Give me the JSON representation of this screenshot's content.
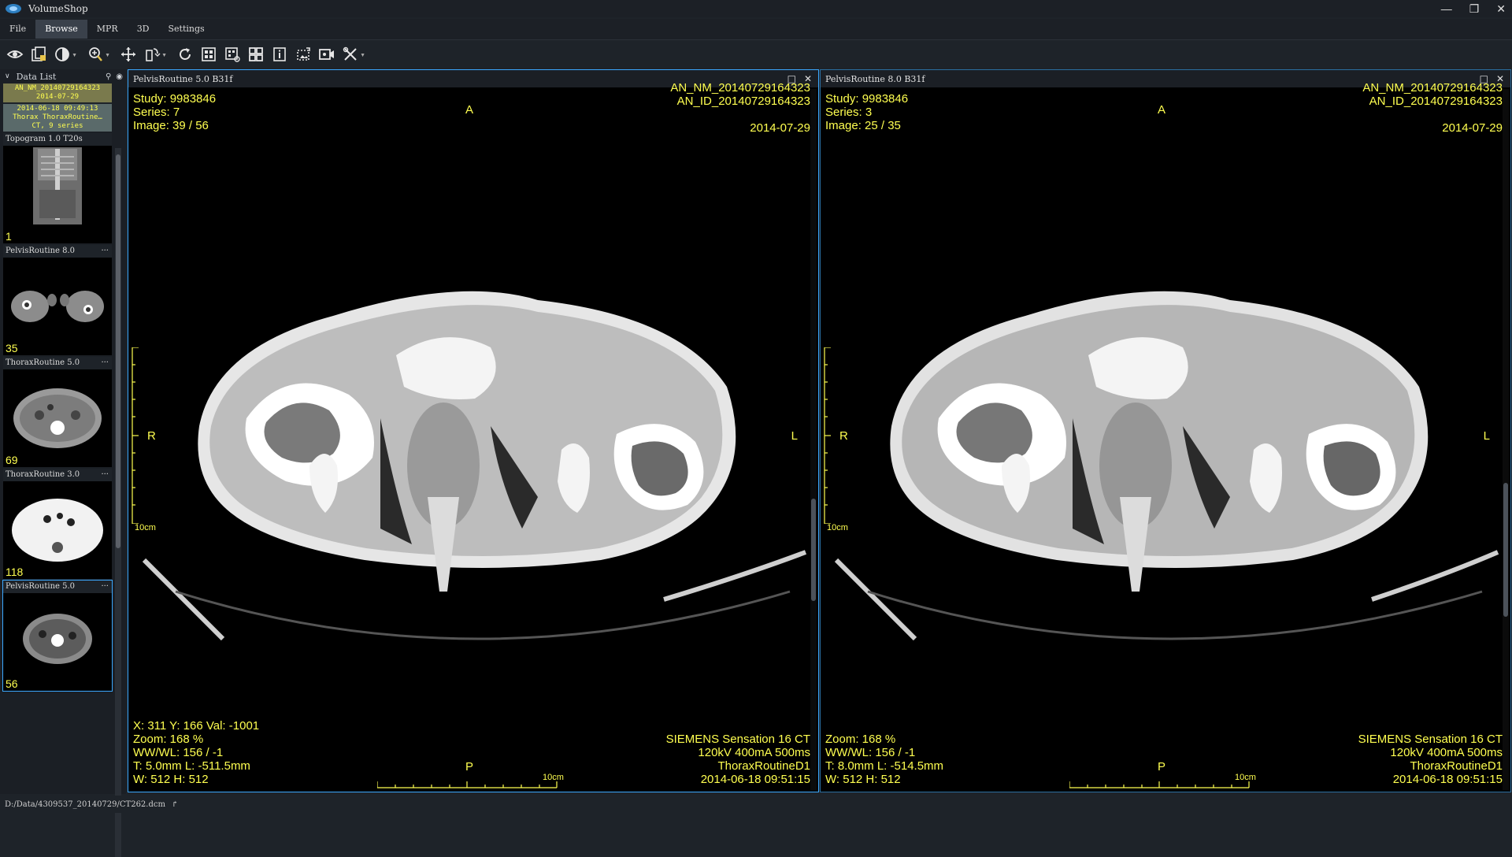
{
  "window": {
    "title": "VolumeShop"
  },
  "menu": [
    "File",
    "Browse",
    "MPR",
    "3D",
    "Settings"
  ],
  "menu_active": "Browse",
  "toolbar_icons": [
    "eye-icon",
    "layers-icon",
    "contrast-icon",
    "zoom-icon",
    "pan-icon",
    "flip-icon",
    "rotate-icon",
    "grid-icon",
    "layout-icon",
    "tiles-icon",
    "info-icon",
    "crop-icon",
    "video-icon",
    "tools-icon"
  ],
  "data_list": {
    "header": "Data List",
    "patient": {
      "name_line": "AN_NM_20140729164323",
      "date_line": "2014-07-29"
    },
    "study": {
      "line1": "2014-06-18  09:49:13",
      "line2": "Thorax ThoraxRoutine…",
      "line3": "CT, 9 series"
    },
    "series": [
      {
        "label": "Topogram   1.0   T20s",
        "count": "1",
        "more": ""
      },
      {
        "label": "PelvisRoutine  8.0",
        "count": "35",
        "more": "···"
      },
      {
        "label": "ThoraxRoutine  5.0",
        "count": "69",
        "more": "···"
      },
      {
        "label": "ThoraxRoutine  3.0",
        "count": "118",
        "more": "···"
      },
      {
        "label": "PelvisRoutine  5.0",
        "count": "56",
        "more": "···"
      }
    ]
  },
  "viewports": [
    {
      "header": "PelvisRoutine   5.0   B31f",
      "tl": [
        "Study: 9983846",
        "Series: 7",
        "Image: 39 / 56"
      ],
      "tr": [
        "AN_NM_20140729164323",
        "AN_ID_20140729164323",
        "",
        "2014-07-29"
      ],
      "top": "A",
      "left": "R",
      "right": "L",
      "bottom": "P",
      "scale_v": "10cm",
      "scale_h": "10cm",
      "bl": [
        "X: 311  Y: 166  Val: -1001",
        "Zoom: 168 %",
        "WW/WL: 156 / -1",
        "T: 5.0mm  L: -511.5mm",
        "W: 512  H: 512"
      ],
      "br": [
        "SIEMENS  Sensation 16  CT",
        "120kV  400mA  500ms",
        "ThoraxRoutineD1",
        "2014-06-18 09:51:15"
      ]
    },
    {
      "header": "PelvisRoutine   8.0   B31f",
      "tl": [
        "Study: 9983846",
        "Series: 3",
        "Image: 25 / 35"
      ],
      "tr": [
        "AN_NM_20140729164323",
        "AN_ID_20140729164323",
        "",
        "2014-07-29"
      ],
      "top": "A",
      "left": "R",
      "right": "L",
      "bottom": "P",
      "scale_v": "10cm",
      "scale_h": "10cm",
      "bl": [
        "",
        "Zoom: 168 %",
        "WW/WL: 156 / -1",
        "T: 8.0mm  L: -514.5mm",
        "W: 512  H: 512"
      ],
      "br": [
        "SIEMENS  Sensation 16  CT",
        "120kV  400mA  500ms",
        "ThoraxRoutineD1",
        "2014-06-18 09:51:15"
      ]
    }
  ],
  "status": {
    "path": "D:/Data/4309537_20140729/CT262.dcm",
    "arrow": "↱"
  }
}
